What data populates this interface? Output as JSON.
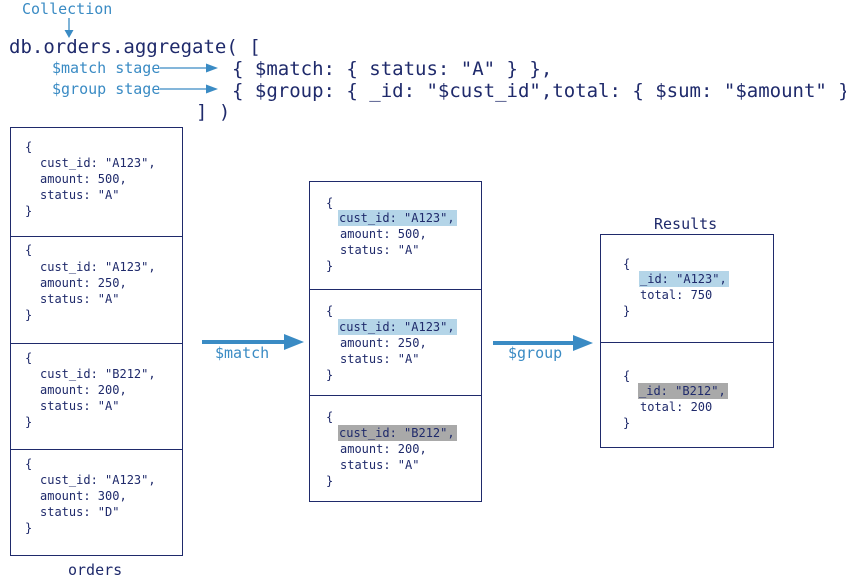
{
  "header": {
    "collection_label": "Collection",
    "command_line": "db.orders.aggregate( [",
    "stages": [
      {
        "label": "$match stage",
        "code": "{ $match: { status: \"A\" } },"
      },
      {
        "label": "$group stage",
        "code": "{ $group: { _id: \"$cust_id\",total: { $sum: \"$amount\" } } }"
      }
    ],
    "closing": "] )"
  },
  "orders": {
    "caption": "orders",
    "documents": [
      {
        "open": "{",
        "lines": [
          "cust_id: \"A123\",",
          "amount: 500,",
          "status: \"A\""
        ],
        "close": "}"
      },
      {
        "open": "{",
        "lines": [
          "cust_id: \"A123\",",
          "amount: 250,",
          "status: \"A\""
        ],
        "close": "}"
      },
      {
        "open": "{",
        "lines": [
          "cust_id: \"B212\",",
          "amount: 200,",
          "status: \"A\""
        ],
        "close": "}"
      },
      {
        "open": "{",
        "lines": [
          "cust_id: \"A123\",",
          "amount: 300,",
          "status: \"D\""
        ],
        "close": "}"
      }
    ]
  },
  "arrows": {
    "match_label": "$match",
    "group_label": "$group"
  },
  "matched": {
    "documents": [
      {
        "open": "{",
        "highlight": "blue",
        "lines": [
          "cust_id: \"A123\",",
          "amount: 500,",
          "status: \"A\""
        ],
        "close": "}"
      },
      {
        "open": "{",
        "highlight": "blue",
        "lines": [
          "cust_id: \"A123\",",
          "amount: 250,",
          "status: \"A\""
        ],
        "close": "}"
      },
      {
        "open": "{",
        "highlight": "gray",
        "lines": [
          "cust_id: \"B212\",",
          "amount: 200,",
          "status: \"A\""
        ],
        "close": "}"
      }
    ]
  },
  "results": {
    "title": "Results",
    "documents": [
      {
        "open": "{",
        "highlight": "blue",
        "lines": [
          "_id: \"A123\",",
          "total: 750"
        ],
        "close": "}"
      },
      {
        "open": "{",
        "highlight": "gray",
        "lines": [
          "_id: \"B212\",",
          "total: 200"
        ],
        "close": "}"
      }
    ]
  },
  "colors": {
    "navy": "#1f2a6b",
    "accent_blue": "#3a8bc4",
    "highlight_blue": "#b4d5e8",
    "highlight_gray": "#a9a9a9"
  }
}
